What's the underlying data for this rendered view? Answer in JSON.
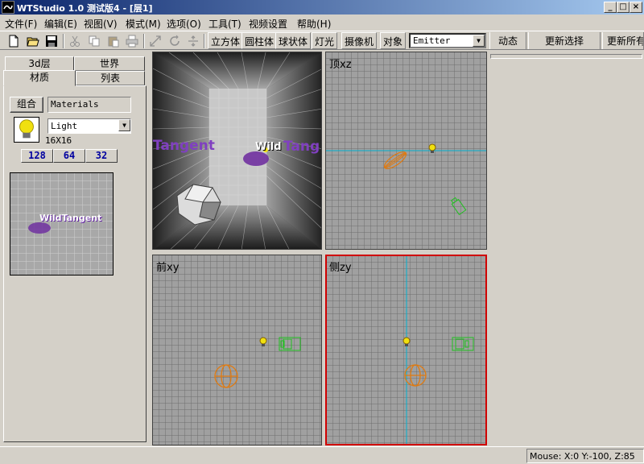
{
  "window": {
    "title": "WTStudio 1.0 测试版4 - [层1]",
    "controls": [
      "_",
      "□",
      "×"
    ]
  },
  "menu": [
    "文件(F)",
    "编辑(E)",
    "视图(V)",
    "模式(M)",
    "选项(O)",
    "工具(T)",
    "视频设置",
    "帮助(H)"
  ],
  "toolbar": {
    "icons": [
      "new-file-icon",
      "open-folder-icon",
      "save-icon",
      "cut-icon",
      "copy-icon",
      "paste-icon",
      "print-icon",
      "move-icon",
      "rotate-icon",
      "scale-icon"
    ],
    "create_buttons": [
      "立方体",
      "圆柱体",
      "球状体",
      "灯光",
      "摄像机",
      "对象"
    ],
    "object_select": "Emitter",
    "right_buttons": [
      "动态",
      "更新选择",
      "更新所有"
    ]
  },
  "left_panel": {
    "tabs_back": [
      "3d层",
      "世界"
    ],
    "tabs_front": [
      "材质",
      "列表"
    ],
    "group_button": "组合",
    "materials_field": "Materials",
    "material_select": "Light",
    "size_text": "16X16",
    "size_buttons": [
      "128",
      "64",
      "32"
    ],
    "preview_logo": "WildTangent"
  },
  "viewports": {
    "top": "顶xz",
    "front": "前xy",
    "side": "侧zy",
    "perspective_logo_left": "Tangent",
    "perspective_logo_right_a": "Wild",
    "perspective_logo_right_b": "Tang"
  },
  "status": {
    "mouse": "Mouse: X:0 Y:-100, Z:85"
  },
  "colors": {
    "title_start": "#0a246a",
    "title_end": "#a6caf0",
    "grid_bg": "#a0a0a0",
    "grid_line": "#6e6e6e",
    "axis": "#00b0d0",
    "active_border": "#d00000",
    "light_object": "#e07a10",
    "camera_object": "#20c020"
  }
}
